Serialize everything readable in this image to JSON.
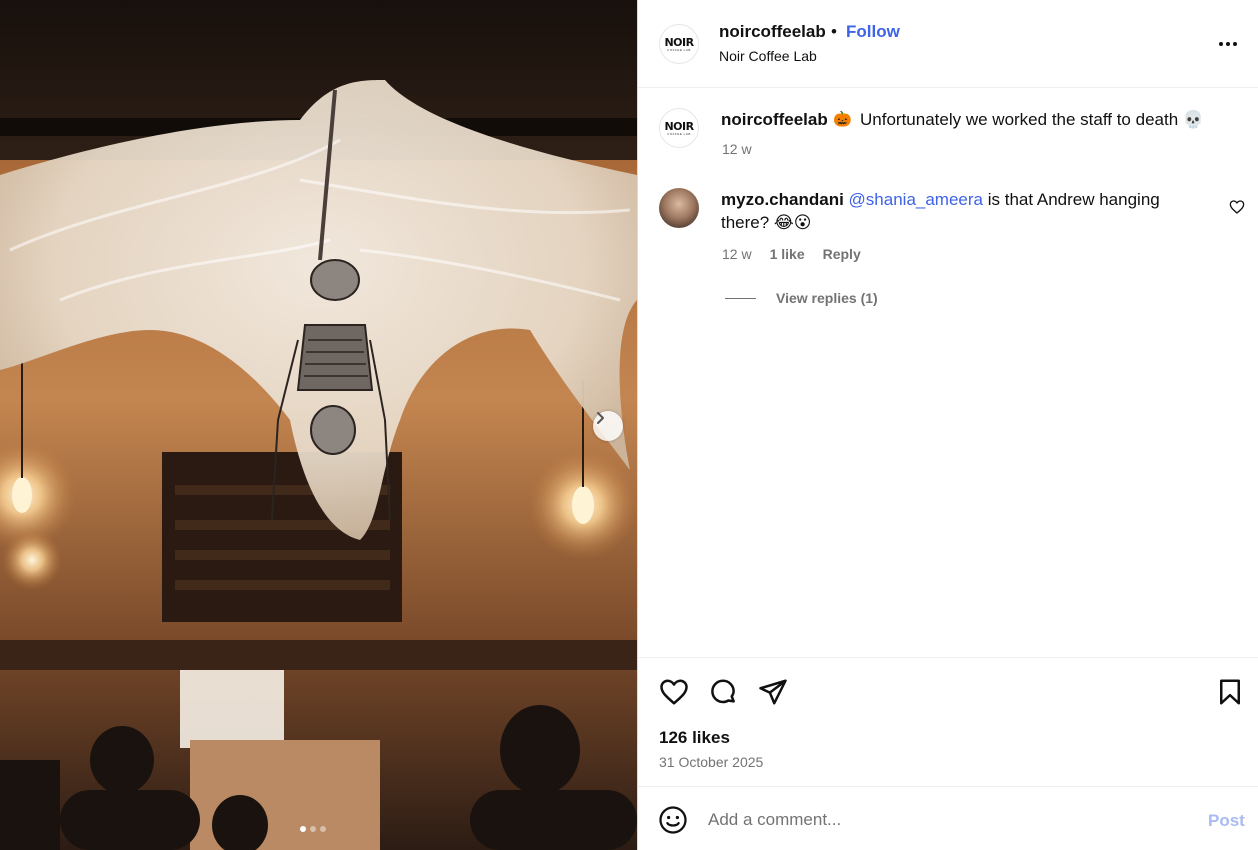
{
  "post": {
    "media": {
      "dots_count": 3,
      "active_dot": 1
    },
    "header": {
      "username": "noircoffeelab",
      "separator": "•",
      "follow_label": "Follow",
      "location": "Noir Coffee Lab",
      "avatar_text": "NOIR",
      "avatar_subtext": "COFFEE LAB"
    },
    "caption": {
      "username": "noircoffeelab",
      "emoji_before": "🎃",
      "text": "Unfortunately we worked the staff to death 💀",
      "time": "12 w"
    },
    "comments": [
      {
        "username": "myzo.chandani",
        "mention": "@shania_ameera",
        "text_line1": " is that Andrew hanging",
        "text_line2": "there? 😂😮",
        "time": "12 w",
        "likes": "1 like",
        "reply_label": "Reply",
        "view_replies": "View replies (1)"
      }
    ],
    "footer": {
      "likes": "126 likes",
      "date": "31 October 2025",
      "comment_placeholder": "Add a comment...",
      "post_label": "Post"
    }
  },
  "colors": {
    "link_blue": "#3e63e6",
    "muted": "#737373",
    "post_disabled": "#a9bbf0"
  }
}
